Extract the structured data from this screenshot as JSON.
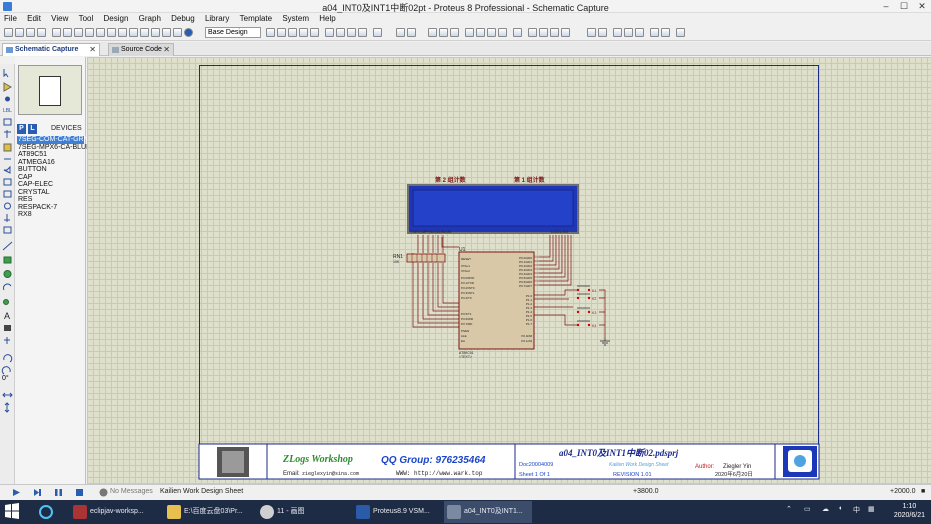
{
  "window": {
    "title": "a04_INT0及INT1中断02pt - Proteus 8 Professional - Schematic Capture",
    "controls": [
      "–",
      "☐",
      "✕"
    ]
  },
  "menu": [
    "File",
    "Edit",
    "View",
    "Tool",
    "Design",
    "Graph",
    "Debug",
    "Library",
    "Template",
    "System",
    "Help"
  ],
  "toolbar": {
    "design_select": "Base Design"
  },
  "tabs": [
    {
      "label": "Schematic Capture",
      "close": "✕"
    },
    {
      "label": "Source Code",
      "close": "✕"
    }
  ],
  "devices": {
    "p_label": "P",
    "l_label": "L",
    "header": "DEVICES",
    "items": [
      "7SEG-COM-CAT-GRN",
      "7SEG-MPX6-CA-BLUE",
      "AT89C51",
      "ATMEGA16",
      "BUTTON",
      "CAP",
      "CAP-ELEC",
      "CRYSTAL",
      "RES",
      "RESPACK-7",
      "RX8"
    ],
    "selected_index": 0
  },
  "rotation": "0°",
  "schematic": {
    "lcd_label_left": "第 2 组计数",
    "lcd_label_right": "第 1 组计数",
    "lcd_bottom_left": "7SEG-MPX6-CA-BLUE",
    "lcd_bottom_right": "LCD1-SG",
    "rn_label": "RN1",
    "rn_sub": "10K",
    "u1_label": "U1",
    "u1_part": "AT89C51",
    "u1_text": "<TEXT>",
    "pins_left": [
      "RESET",
      "XTAL1",
      "XTAL2",
      "P3.0/RXD",
      "P3.1/TXD",
      "P3.2/INT0",
      "P3.3/INT1",
      "P3.4/T0",
      "P3.5/T1",
      "P3.6/WR",
      "P3.7/RD",
      "PSEN",
      "ALE",
      "EA"
    ],
    "pins_right": [
      "P0.0/AD0",
      "P0.1/AD1",
      "P0.2/AD2",
      "P0.3/AD3",
      "P0.4/AD4",
      "P0.5/AD5",
      "P0.6/AD6",
      "P0.7/AD7",
      "P2.0/A8",
      "P2.1/A9",
      "P2.2/A10",
      "P2.3/A11",
      "P2.4/A12",
      "P2.5/A13",
      "P2.6/A14",
      "P2.7/A15",
      "P1.0",
      "P1.1",
      "P1.2",
      "P1.3",
      "P1.4",
      "P1.5",
      "P1.6",
      "P1.7"
    ],
    "buttons": [
      "K1",
      "K2",
      "K3",
      "K4"
    ]
  },
  "titleblock": {
    "logo_text": "ZLogs Workshop",
    "qq": "QQ Group: 976235464",
    "email_label": "Email:",
    "email": "zieglexyin@sina.com",
    "www": "WWW: http://www.wark.top",
    "project": "a04_INT0及INT1中断02.pdsprj",
    "doc": "Doc20004009",
    "company": "Kailien Work Design Sheet",
    "author_label": "Author:",
    "author": "Ziegler Yin",
    "sheet": "Sheet  1  Of  1",
    "revision": "REVISION  1.01",
    "date": "2020年6月20日"
  },
  "status": {
    "messages": "No Messages",
    "sheet": "Kailien Work Design Sheet",
    "coord_x": "+3800.0",
    "coord_y": "+2000.0"
  },
  "taskbar": {
    "items": [
      {
        "label": "eclipjav-worksp..."
      },
      {
        "label": "E:\\百度云盘03\\Pr..."
      },
      {
        "label": "11 - 画图"
      },
      {
        "label": "Proteus8.9 VSM..."
      },
      {
        "label": "a04_INT0及INT1..."
      }
    ],
    "ime": "中",
    "time": "1:10",
    "date": "2020/6/21"
  },
  "colors": {
    "accent": "#2a5db0",
    "canvas_bg": "#dfe0cc",
    "lcd_blue": "#1f36b8",
    "wire": "#7a1515",
    "taskbar": "#1d2b45"
  }
}
